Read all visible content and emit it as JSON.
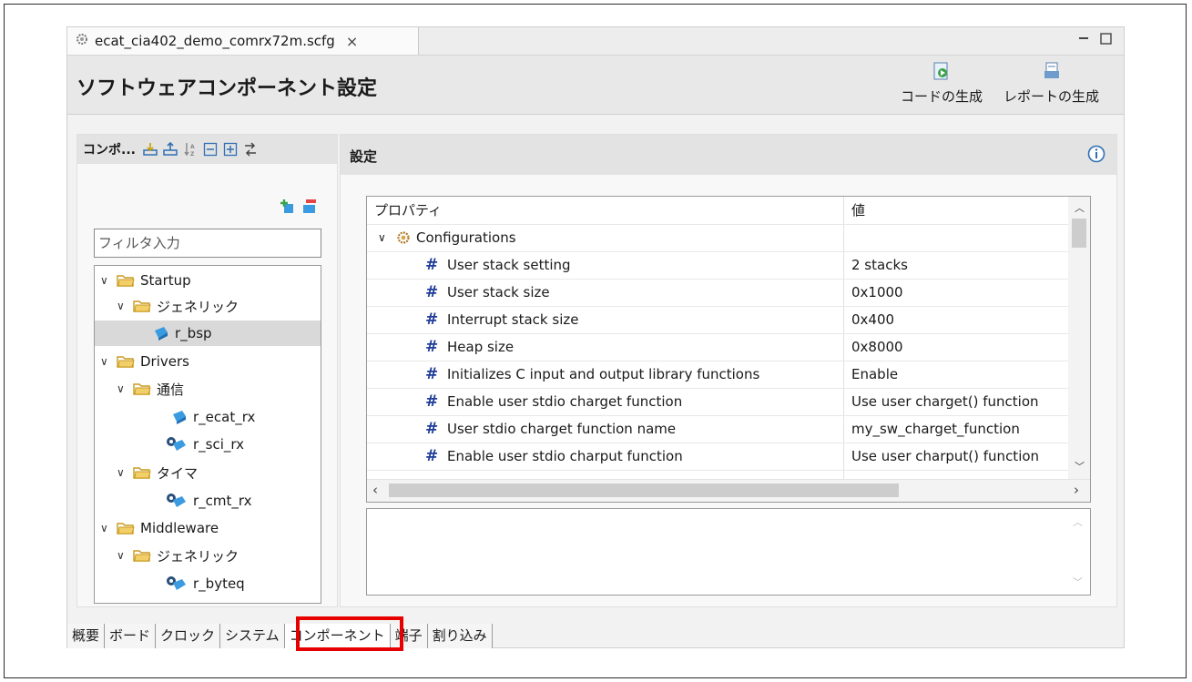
{
  "editor_tab": {
    "title": "ecat_cia402_demo_comrx72m.scfg",
    "close": "×"
  },
  "window_controls": {
    "minimize": "▭",
    "maximize": "□"
  },
  "header": {
    "title": "ソフトウェアコンポーネント設定",
    "generate_code": "コードの生成",
    "generate_report": "レポートの生成"
  },
  "left_panel": {
    "title": "コンポ...",
    "filter_placeholder": "フィルタ入力",
    "tree": [
      {
        "label": "Startup",
        "type": "folder",
        "expanded": true
      },
      {
        "label": "ジェネリック",
        "type": "folder",
        "expanded": true
      },
      {
        "label": "r_bsp",
        "type": "component",
        "selected": true
      },
      {
        "label": "Drivers",
        "type": "folder",
        "expanded": true
      },
      {
        "label": "通信",
        "type": "folder",
        "expanded": true
      },
      {
        "label": "r_ecat_rx",
        "type": "component"
      },
      {
        "label": "r_sci_rx",
        "type": "component-config"
      },
      {
        "label": "タイマ",
        "type": "folder",
        "expanded": true
      },
      {
        "label": "r_cmt_rx",
        "type": "component-config"
      },
      {
        "label": "Middleware",
        "type": "folder",
        "expanded": true
      },
      {
        "label": "ジェネリック",
        "type": "folder",
        "expanded": true
      },
      {
        "label": "r_byteq",
        "type": "component-config"
      }
    ]
  },
  "right_panel": {
    "title": "設定",
    "table": {
      "col_property": "プロパティ",
      "col_value": "値",
      "group": "Configurations",
      "rows": [
        {
          "property": "User stack setting",
          "value": "2 stacks"
        },
        {
          "property": "User stack size",
          "value": "0x1000"
        },
        {
          "property": "Interrupt stack size",
          "value": "0x400"
        },
        {
          "property": "Heap size",
          "value": "0x8000"
        },
        {
          "property": "Initializes C input and output library functions",
          "value": "Enable"
        },
        {
          "property": "Enable user stdio charget function",
          "value": "Use user charget() function"
        },
        {
          "property": "User stdio charget function name",
          "value": "my_sw_charget_function"
        },
        {
          "property": "Enable user stdio charput function",
          "value": "Use user charput() function"
        }
      ]
    }
  },
  "bottom_tabs": [
    "概要",
    "ボード",
    "クロック",
    "システム",
    "コンポーネント",
    "端子",
    "割り込み"
  ],
  "active_bottom_tab": "コンポーネント",
  "colors": {
    "highlight_box": "#e60000",
    "hash_icon": "#1f3c99",
    "folder": "#e8b84a",
    "component": "#3a9be0"
  }
}
